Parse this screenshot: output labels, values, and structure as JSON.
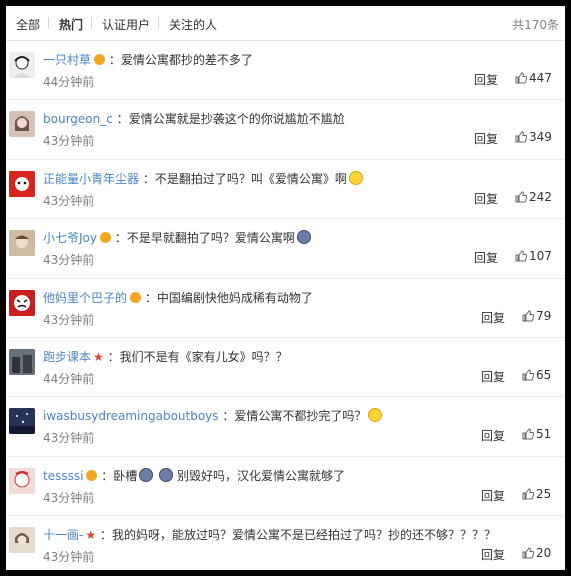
{
  "tabs": [
    {
      "label": "全部"
    },
    {
      "label": "热门"
    },
    {
      "label": "认证用户"
    },
    {
      "label": "关注的人"
    }
  ],
  "total_count": "共170条",
  "reply_label": "回复",
  "comments": [
    {
      "user": "一只村草",
      "sep": "：",
      "text": "爱情公寓都抄的差不多了",
      "time": "44分钟前",
      "likes": "447",
      "avatar_color": "#e8e8e8"
    },
    {
      "user": "bourgeon_c",
      "sep": "：",
      "text": "爱情公寓就是抄袭这个的你说尴尬不尴尬",
      "time": "43分钟前",
      "likes": "349",
      "avatar_color": "#c9a79b"
    },
    {
      "user": "正能量小青年尘器",
      "sep": "：",
      "text": "不是翻拍过了吗？叫《爱情公寓》啊",
      "time": "43分钟前",
      "likes": "242",
      "avatar_color": "#d9261c"
    },
    {
      "user": "小七爷Joy",
      "sep": "：",
      "text": "不是早就翻拍了吗？爱情公寓啊",
      "time": "43分钟前",
      "likes": "107",
      "avatar_color": "#d8c8b4"
    },
    {
      "user": "他妈里个巴子的",
      "sep": "：",
      "text": "中国编剧快他妈成稀有动物了",
      "time": "43分钟前",
      "likes": "79",
      "avatar_color": "#c81e1e"
    },
    {
      "user": "跑步课本",
      "sep": "：",
      "text": "我们不是有《家有儿女》吗？？",
      "time": "44分钟前",
      "likes": "65",
      "avatar_color": "#555c64"
    },
    {
      "user": "iwasbusydreamingaboutboys",
      "sep": "：",
      "text": "爱情公寓不都抄完了吗？",
      "time": "43分钟前",
      "likes": "51",
      "avatar_color": "#2e3c68"
    },
    {
      "user": "tessssi",
      "sep": "：",
      "text_parts": [
        "卧槽",
        "别毁好吗，汉化爱情公寓就够了"
      ],
      "time": "43分钟前",
      "likes": "25",
      "avatar_color": "#e6c4c0"
    },
    {
      "user": "十一画-",
      "sep": "：",
      "text": "我的妈呀，能放过吗？爱情公寓不是已经拍过了吗？抄的还不够？？？？",
      "time": "43分钟前",
      "likes": "20",
      "avatar_color": "#e2d6cc"
    }
  ]
}
